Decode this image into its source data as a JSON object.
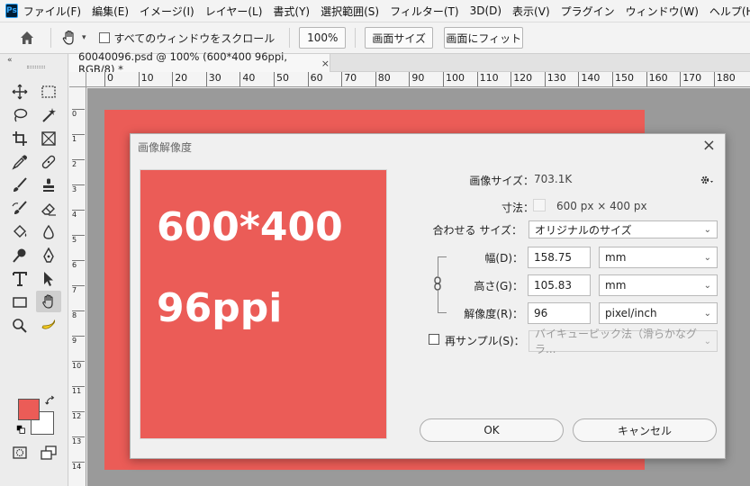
{
  "app": {
    "logo": "Ps"
  },
  "menu": [
    "ファイル(F)",
    "編集(E)",
    "イメージ(I)",
    "レイヤー(L)",
    "書式(Y)",
    "選択範囲(S)",
    "フィルター(T)",
    "3D(D)",
    "表示(V)",
    "プラグイン",
    "ウィンドウ(W)",
    "ヘルプ(H)"
  ],
  "options": {
    "all_windows_label": "すべてのウィンドウをスクロール",
    "zoom_value": "100%",
    "fit_screen_label": "画面サイズ",
    "fill_screen_label": "画面にフィット"
  },
  "document": {
    "tab_title": "60040096.psd @ 100% (600*400 96ppi, RGB/8) *",
    "tab_close": "×"
  },
  "ruler_top_labels": [
    "0",
    "10",
    "20",
    "30",
    "40",
    "50",
    "60",
    "70",
    "80",
    "90",
    "100",
    "110",
    "120",
    "130",
    "140",
    "150",
    "160",
    "170",
    "180"
  ],
  "ruler_left_labels": [
    "0",
    "1",
    "2",
    "3",
    "4",
    "5",
    "6",
    "7",
    "8",
    "9",
    "10",
    "11",
    "12",
    "13",
    "14"
  ],
  "colors": {
    "foreground": "#eb5c57",
    "background": "#ffffff",
    "canvas": "#eb5c57"
  },
  "dialog": {
    "title": "画像解像度",
    "close": "×",
    "preview_line1": "600*400",
    "preview_line2": "96ppi",
    "image_size_label": "画像サイズ：",
    "image_size_value": "703.1K",
    "dimensions_label": "寸法：",
    "dimensions_value": "600 px × 400 px",
    "fit_to_label": "合わせる サイズ：",
    "fit_to_value": "オリジナルのサイズ",
    "width_label": "幅(D)：",
    "width_value": "158.75",
    "width_unit": "mm",
    "height_label": "高さ(G)：",
    "height_value": "105.83",
    "height_unit": "mm",
    "resolution_label": "解像度(R)：",
    "resolution_value": "96",
    "resolution_unit": "pixel/inch",
    "resample_label": "再サンプル(S)：",
    "resample_value": "バイキュービック法（滑らかなグラ...",
    "ok_label": "OK",
    "cancel_label": "キャンセル"
  }
}
